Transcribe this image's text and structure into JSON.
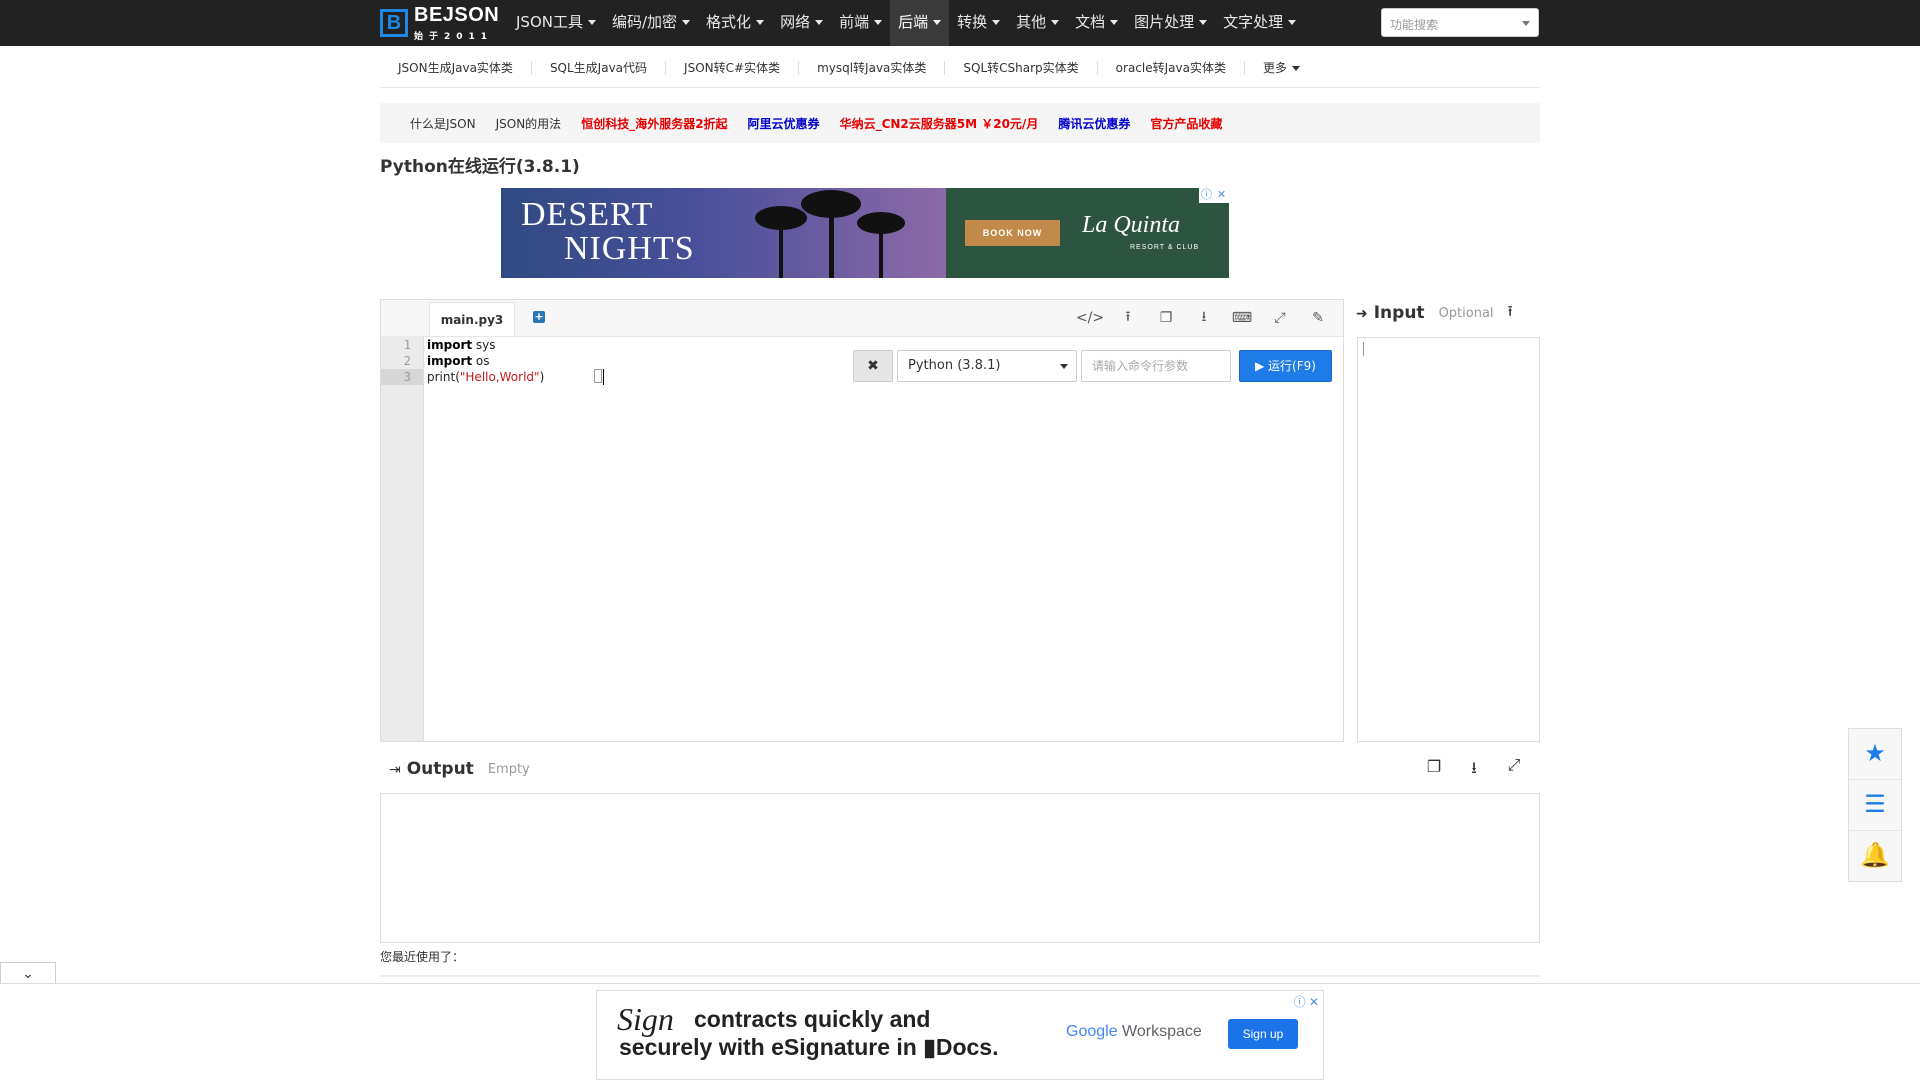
{
  "brand": {
    "name": "BEJSON",
    "tagline": "始于2011",
    "mark": "B"
  },
  "nav": {
    "items": [
      {
        "label": "JSON工具"
      },
      {
        "label": "编码/加密"
      },
      {
        "label": "格式化"
      },
      {
        "label": "网络"
      },
      {
        "label": "前端"
      },
      {
        "label": "后端"
      },
      {
        "label": "转换"
      },
      {
        "label": "其他"
      },
      {
        "label": "文档"
      },
      {
        "label": "图片处理"
      },
      {
        "label": "文字处理"
      }
    ],
    "active": "后端",
    "search_placeholder": "功能搜索"
  },
  "subnav": {
    "items": [
      "JSON生成Java实体类",
      "SQL生成Java代码",
      "JSON转C#实体类",
      "mysql转Java实体类",
      "SQL转CSharp实体类",
      "oracle转Java实体类",
      "更多"
    ]
  },
  "links": [
    {
      "label": "什么是JSON",
      "style": "dark"
    },
    {
      "label": "JSON的用法",
      "style": "dark"
    },
    {
      "label": "恒创科技_海外服务器2折起",
      "style": "red"
    },
    {
      "label": "阿里云优惠券",
      "style": "blue"
    },
    {
      "label": "华纳云_CN2云服务器5M ￥20元/月",
      "style": "red"
    },
    {
      "label": "腾讯云优惠券",
      "style": "blue"
    },
    {
      "label": "官方产品收藏",
      "style": "red"
    }
  ],
  "page": {
    "title": "Python在线运行(3.8.1)"
  },
  "ad_top": {
    "line1": "DESERT",
    "line2": "NIGHTS",
    "button": "BOOK NOW",
    "brand": "La Quinta",
    "brand_sub": "RESORT & CLUB"
  },
  "editor": {
    "tab": "main.py3",
    "line_numbers": [
      "1",
      "2",
      "3"
    ],
    "code": {
      "l1_kw": "import",
      "l1_rest": " sys",
      "l2_kw": "import",
      "l2_rest": " os",
      "l3_fn": "print(",
      "l3_str": "\"Hello,World\"",
      "l3_end": ")"
    },
    "tools": [
      "code-icon",
      "upload-icon",
      "copy-icon",
      "download-icon",
      "keyboard-icon",
      "fullscreen-icon",
      "edit-icon"
    ]
  },
  "run": {
    "clear": "✖",
    "language": "Python (3.8.1)",
    "args_placeholder": "请输入命令行参数",
    "run_label": "▶ 运行(F9)"
  },
  "input": {
    "title": "Input",
    "subtitle": "Optional"
  },
  "output": {
    "title": "Output",
    "subtitle": "Empty"
  },
  "recent": {
    "label": "您最近使用了："
  },
  "ad_bottom": {
    "sign": "Sign",
    "line1": "contracts quickly and",
    "line2": "securely with eSignature in ▮Docs.",
    "google_g": "Google",
    "google_rest": " Workspace",
    "button": "Sign up"
  },
  "colors": {
    "navbar": "#222222",
    "run_button": "#1e7ce8",
    "accent": "#1e88e5"
  }
}
